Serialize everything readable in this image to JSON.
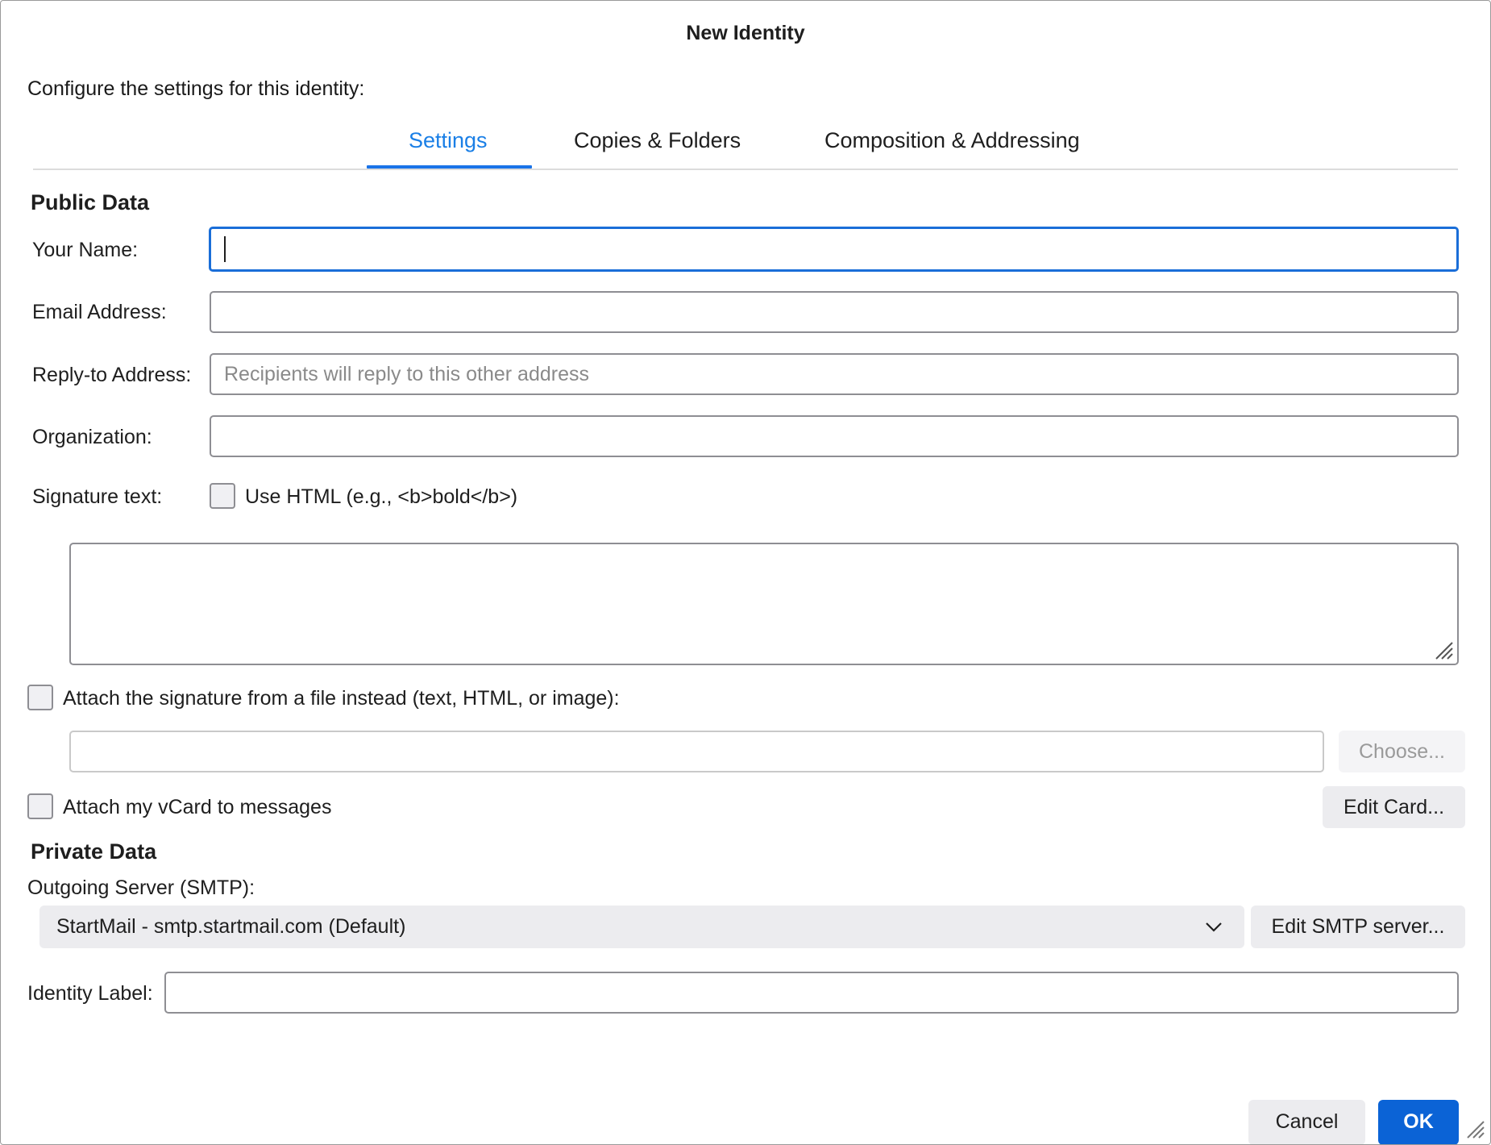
{
  "dialog": {
    "title": "New Identity",
    "intro": "Configure the settings for this identity:"
  },
  "tabs": [
    {
      "label": "Settings",
      "active": true
    },
    {
      "label": "Copies & Folders",
      "active": false
    },
    {
      "label": "Composition & Addressing",
      "active": false
    }
  ],
  "public_data": {
    "heading": "Public Data",
    "your_name": {
      "label": "Your Name:",
      "value": ""
    },
    "email": {
      "label": "Email Address:",
      "value": ""
    },
    "reply_to": {
      "label": "Reply-to Address:",
      "value": "",
      "placeholder": "Recipients will reply to this other address"
    },
    "organization": {
      "label": "Organization:",
      "value": ""
    },
    "signature": {
      "label": "Signature text:",
      "use_html_label": "Use HTML (e.g., <b>bold</b>)",
      "use_html_checked": false,
      "text": ""
    },
    "attach_file": {
      "label": "Attach the signature from a file instead (text, HTML, or image):",
      "checked": false,
      "path": "",
      "choose_label": "Choose..."
    },
    "vcard": {
      "label": "Attach my vCard to messages",
      "checked": false,
      "edit_label": "Edit Card..."
    }
  },
  "private_data": {
    "heading": "Private Data",
    "smtp_label": "Outgoing Server (SMTP):",
    "smtp_selected": "StartMail - smtp.startmail.com (Default)",
    "edit_smtp_label": "Edit SMTP server..."
  },
  "identity_label": {
    "label": "Identity Label:",
    "value": ""
  },
  "footer": {
    "cancel_label": "Cancel",
    "ok_label": "OK"
  },
  "icons": {
    "dropdown": "chevron-down-icon",
    "resize": "resize-grip-icon"
  },
  "colors": {
    "accent": "#1a73e8",
    "primary_button": "#0b63d6",
    "focus_ring": "#1a6ed8"
  }
}
